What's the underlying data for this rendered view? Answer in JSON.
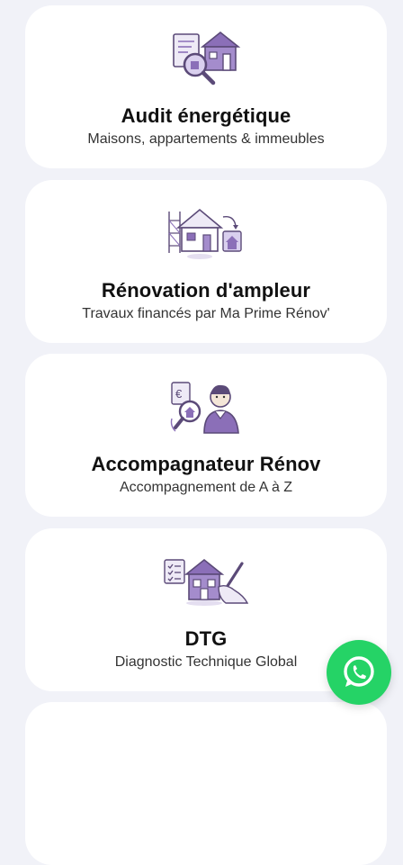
{
  "services": [
    {
      "title": "Audit énergétique",
      "subtitle": "Maisons, appartements & immeubles",
      "icon": "house-magnifier-icon"
    },
    {
      "title": "Rénovation d'ampleur",
      "subtitle": "Travaux financés par Ma Prime Rénov'",
      "icon": "house-renovation-icon"
    },
    {
      "title": "Accompagnateur Rénov",
      "subtitle": "Accompagnement de A à Z",
      "icon": "advisor-icon"
    },
    {
      "title": "DTG",
      "subtitle": "Diagnostic Technique Global",
      "icon": "diagnostic-icon"
    }
  ],
  "whatsapp": {
    "icon": "whatsapp-icon"
  },
  "colors": {
    "accent": "#8b6fb8",
    "accent_dark": "#5b4a78",
    "whatsapp": "#25d366",
    "card": "#ffffff",
    "background": "#f1f2f8"
  }
}
